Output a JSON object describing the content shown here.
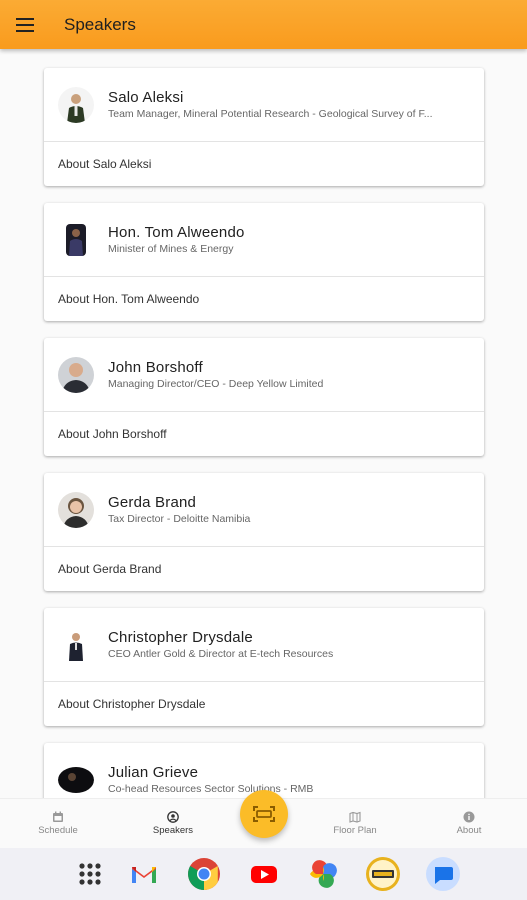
{
  "appbar": {
    "title": "Speakers"
  },
  "speakers": [
    {
      "name": "Salo Aleksi",
      "title": "Team Manager, Mineral Potential Research - Geological Survey of F...",
      "about": "About Salo Aleksi"
    },
    {
      "name": "Hon. Tom Alweendo",
      "title": "Minister of Mines & Energy",
      "about": "About Hon. Tom Alweendo"
    },
    {
      "name": "John Borshoff",
      "title": "Managing Director/CEO - Deep Yellow Limited",
      "about": "About John Borshoff"
    },
    {
      "name": "Gerda Brand",
      "title": "Tax Director - Deloitte Namibia",
      "about": "About Gerda Brand"
    },
    {
      "name": "Christopher Drysdale",
      "title": "CEO Antler Gold & Director at E-tech Resources",
      "about": "About Christopher Drysdale"
    },
    {
      "name": "Julian Grieve",
      "title": "Co-head Resources Sector Solutions - RMB",
      "about": ""
    }
  ],
  "bottomnav": {
    "items": [
      {
        "label": "Schedule",
        "icon": "schedule-icon"
      },
      {
        "label": "Speakers",
        "icon": "speakers-icon"
      },
      {
        "label": "Floor Plan",
        "icon": "map-icon"
      },
      {
        "label": "About",
        "icon": "info-icon"
      }
    ],
    "fab_icon": "scan-icon",
    "active": "Speakers"
  },
  "dock": {
    "apps": [
      "app-drawer",
      "gmail",
      "chrome",
      "youtube",
      "google-photos",
      "expo-app",
      "messages"
    ]
  },
  "colors": {
    "accent": "#f9a327",
    "fab": "#fbbc28"
  }
}
